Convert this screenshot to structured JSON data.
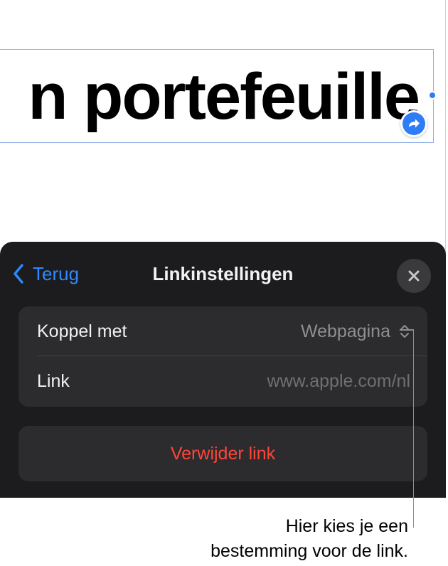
{
  "canvas": {
    "headline": "n portefeuille"
  },
  "panel": {
    "back_label": "Terug",
    "title": "Linkinstellingen",
    "rows": [
      {
        "label": "Koppel met",
        "value": "Webpagina",
        "control": "up-down-chevron-icon"
      },
      {
        "label": "Link",
        "value": "www.apple.com/nl"
      }
    ],
    "delete_label": "Verwijder link"
  },
  "callout": {
    "line1": "Hier kies je een",
    "line2": "bestemming voor de link."
  },
  "colors": {
    "accent": "#2f88ff",
    "panel_bg": "#1c1c1e",
    "group_bg": "#2c2c2e",
    "destructive": "#ff453a",
    "selection": "#8fb1e8"
  },
  "icons": {
    "back": "chevron-left-icon",
    "close": "close-icon",
    "link_badge": "link-arrow-icon",
    "updown": "up-down-chevron-icon"
  }
}
